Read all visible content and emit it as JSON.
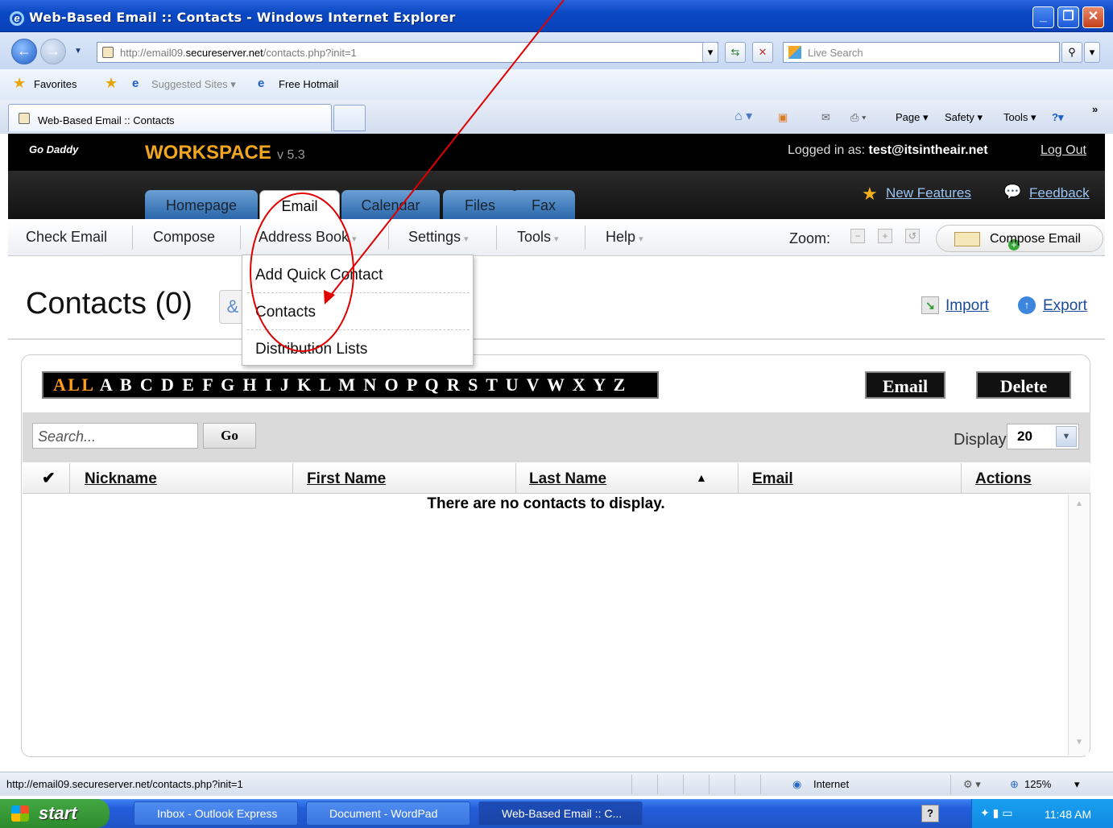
{
  "window": {
    "title": "Web-Based Email :: Contacts - Windows Internet Explorer",
    "min": "_",
    "max": "❐",
    "close": "✕"
  },
  "browser": {
    "address_prefix": "http://email09.",
    "address_domain": "secureserver.net",
    "address_suffix": "/contacts.php?init=1",
    "search_placeholder": "Live Search",
    "favorites": "Favorites",
    "suggested_sites": "Suggested Sites ▾",
    "free_hotmail": "Free Hotmail",
    "tab_title": "Web-Based Email :: Contacts",
    "cmd_page": "Page ▾",
    "cmd_safety": "Safety ▾",
    "cmd_tools": "Tools ▾",
    "cmd_more": "»"
  },
  "app": {
    "logo": "Go Daddy",
    "workspace": "WORKSPACE",
    "version": "v 5.3",
    "logged_in_label": "Logged in as: ",
    "logged_in_user": "test@itsintheair.net",
    "logout": "Log Out",
    "new_features": "New Features",
    "feedback": "Feedback",
    "tabs": [
      "Homepage",
      "Email",
      "Calendar",
      "Files",
      "Fax"
    ],
    "toolbar": {
      "check_email": "Check Email",
      "compose": "Compose",
      "address_book": "Address Book",
      "settings": "Settings",
      "tools": "Tools",
      "help": "Help",
      "zoom": "Zoom:",
      "compose_email": "Compose Email"
    },
    "dropdown": [
      "Add Quick Contact",
      "Contacts",
      "Distribution Lists"
    ],
    "page_title": "Contacts (0)",
    "import": "Import",
    "export": "Export",
    "alpha_all": "ALL",
    "alpha_letters": "A B C D E F G H I J K L M N O P Q R S T U V W X Y Z",
    "email_btn": "Email",
    "delete_btn": "Delete",
    "search_placeholder": "Search...",
    "go": "Go",
    "display_label": "Display",
    "display_value": "20",
    "columns": [
      "Nickname",
      "First Name",
      "Last Name",
      "Email",
      "Actions"
    ],
    "empty_message": "There are no contacts to display."
  },
  "status": {
    "url": "http://email09.secureserver.net/contacts.php?init=1",
    "zone": "Internet",
    "zoom": "125%"
  },
  "taskbar": {
    "start": "start",
    "tasks": [
      "Inbox - Outlook Express",
      "Document - WordPad",
      "Web-Based Email :: C..."
    ],
    "time": "11:48 AM"
  },
  "colors": {
    "accent": "#2a67ab",
    "annotation": "#e00000",
    "alpha_all": "#ff9c1a"
  }
}
